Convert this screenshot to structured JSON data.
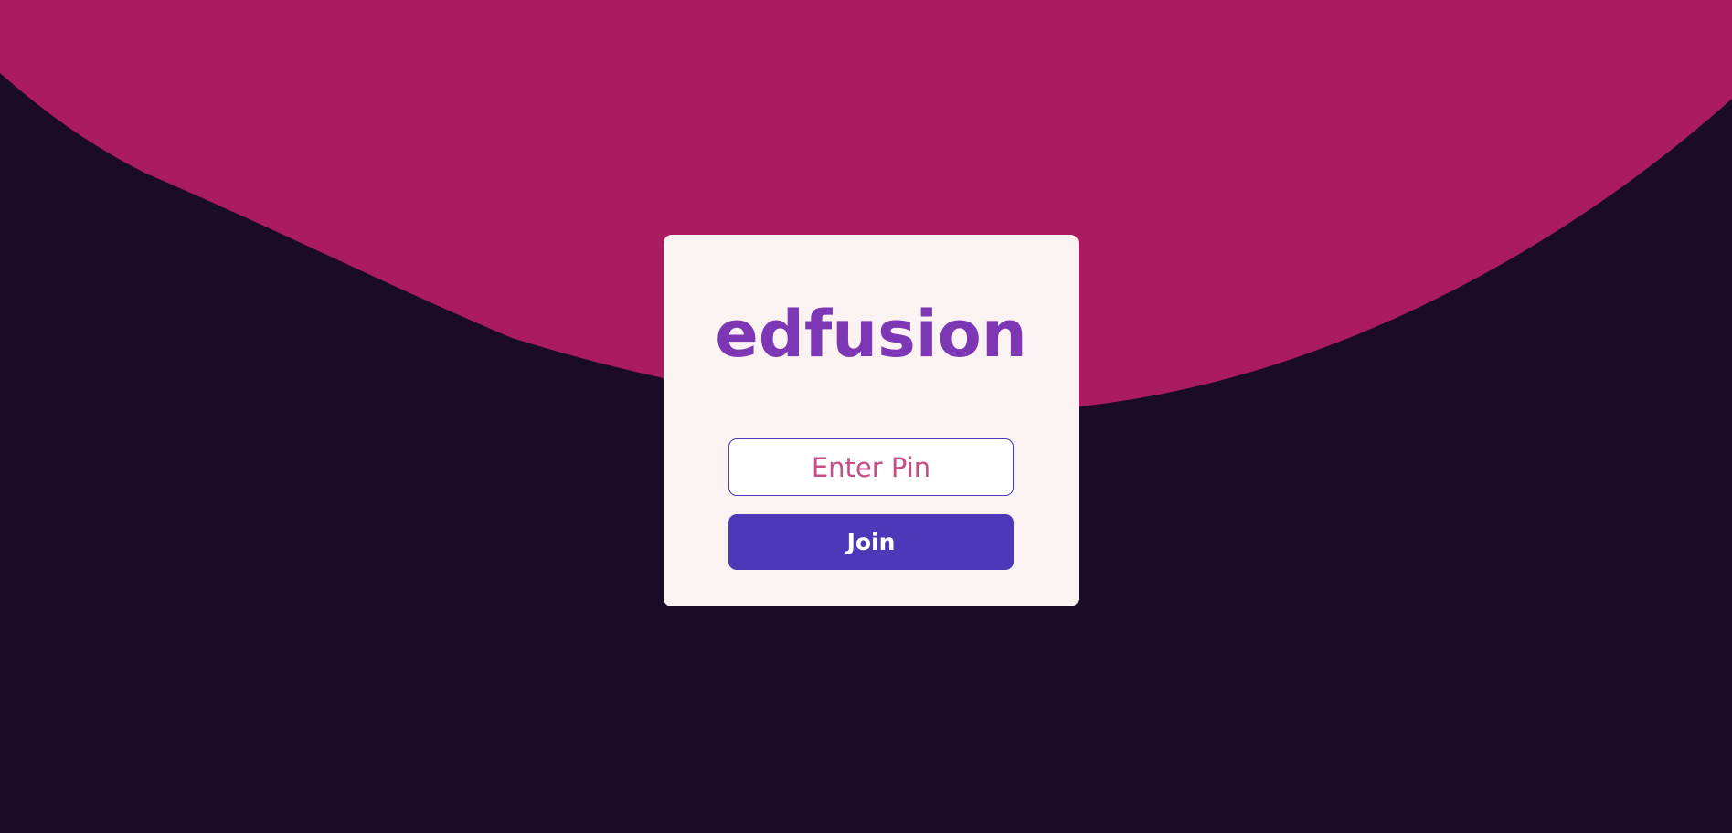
{
  "app": {
    "logo_text": "edfusion"
  },
  "form": {
    "pin_placeholder": "Enter Pin",
    "pin_value": "",
    "join_label": "Join"
  },
  "colors": {
    "background_dark": "#1a0b28",
    "background_wave": "#ab1b61",
    "card_background": "#fbf2f2",
    "brand_purple": "#7d37b5",
    "button_indigo": "#4d39b8",
    "placeholder_pink": "#c54e87"
  }
}
